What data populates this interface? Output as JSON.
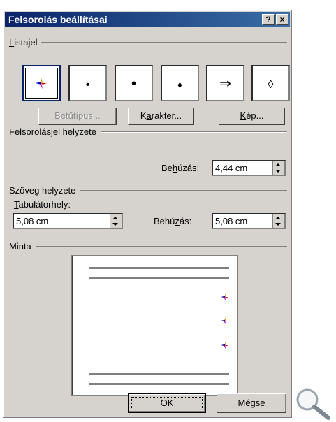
{
  "title": "Felsorolás beállításai",
  "title_buttons": {
    "help": "?",
    "close": "×"
  },
  "listajel": {
    "label_u": "L",
    "label_rest": "istajel",
    "bullets": [
      {
        "name": "picture-bullet",
        "symbol": ""
      },
      {
        "name": "small-dot",
        "symbol": "•"
      },
      {
        "name": "round-dot",
        "symbol": "•"
      },
      {
        "name": "diamond",
        "symbol": "♦"
      },
      {
        "name": "arrow",
        "symbol": "⇒"
      },
      {
        "name": "hollow-diamond",
        "symbol": "◊"
      }
    ]
  },
  "buttons": {
    "betutipus": "Betűtípus...",
    "karakter_pre": "K",
    "karakter_u": "a",
    "karakter_post": "rakter...",
    "kep_u": "K",
    "kep_post": "ép...",
    "ok": "OK",
    "megse": "Mégse"
  },
  "felsorolasjel": {
    "group": "Felsorolásjel helyzete",
    "behuzas_pre": "Be",
    "behuzas_u": "h",
    "behuzas_post": "úzás:",
    "behuzas_value": "4,44 cm"
  },
  "szoveg": {
    "group": "Szöveg helyzete",
    "tab_u": "T",
    "tab_rest": "abulátorhely:",
    "tab_value": "5,08 cm",
    "behuzas_pre": "Behú",
    "behuzas_u": "z",
    "behuzas_post": "ás:",
    "behuzas_value": "5,08 cm"
  },
  "minta": {
    "group": "Minta"
  },
  "colors": {
    "title_bg": "#0a246a",
    "dialog_bg": "#d6d3ce"
  }
}
